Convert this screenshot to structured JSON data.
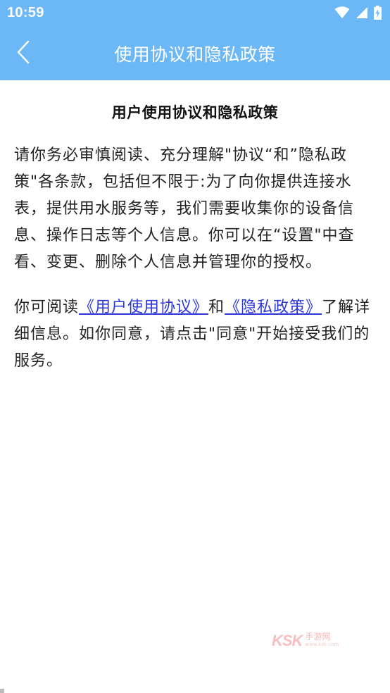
{
  "status_bar": {
    "time": "10:59",
    "icons": [
      "wifi-icon",
      "cell-signal-icon",
      "battery-charging-icon"
    ]
  },
  "app_bar": {
    "title": "使用协议和隐私政策",
    "back_icon": "chevron-left-icon"
  },
  "document": {
    "title": "用户使用协议和隐私政策",
    "paragraph1": "请你务必审慎阅读、充分理解\"协议“和”隐私政策\"各条款，包括但不限于:为了向你提供连接水表，提供用水服务等，我们需要收集你的设备信息、操作日志等个人信息。你可以在“设置\"中查看、变更、删除个人信息并管理你的授权。",
    "paragraph2": {
      "prefix": "你可阅读",
      "user_agreement_link": "《用户使用协议》",
      "middle": "和",
      "privacy_link": "《隐私政策》",
      "suffix": "了解详细信息。如你同意，请点击\"同意\"开始接受我们的服务。"
    }
  },
  "watermark": {
    "logo": "KSK",
    "main": "手游网",
    "sub": "www.ksk.com"
  },
  "colors": {
    "header_bg": "#6cb8f7",
    "link": "#2b36d8",
    "body_text": "#222222"
  }
}
